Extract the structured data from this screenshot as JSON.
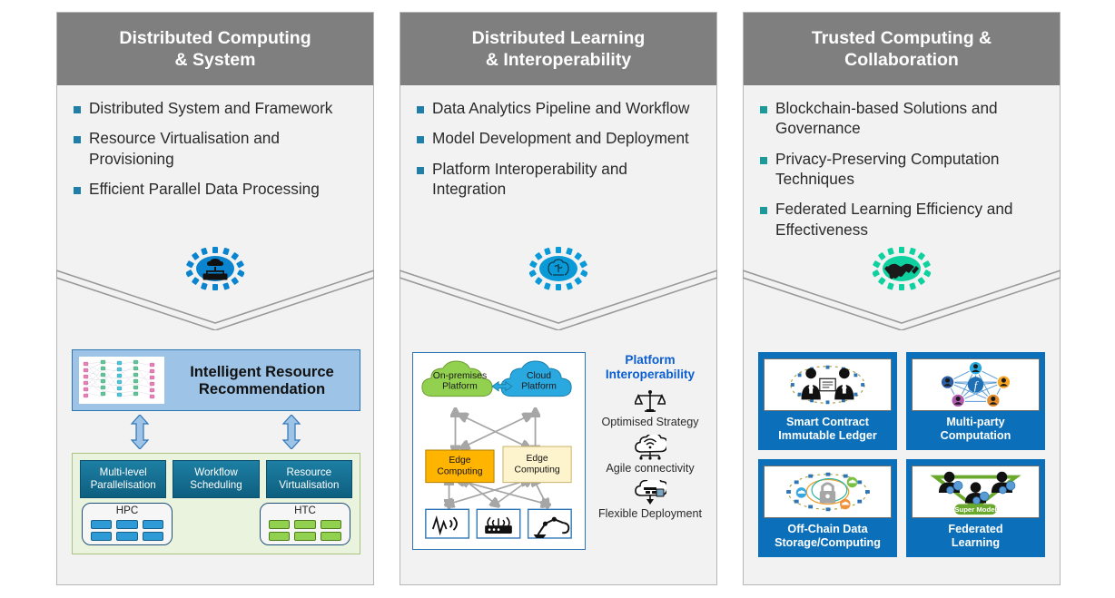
{
  "columns": [
    {
      "id": "distributed-computing",
      "title": "Distributed Computing\n& System",
      "bullet_color": "#1f7fa8",
      "gear_color": "#0b84d0",
      "gear_icon": "cloud-network-icon",
      "bullets": [
        "Distributed System and Framework",
        "Resource Virtualisation and Provisioning",
        "Efficient Parallel Data Processing"
      ],
      "diagram": {
        "headline": "Intelligent Resource\nRecommendation",
        "headline_image": "neural-network-diagram",
        "connector_icon": "double-headed-vertical-arrow",
        "capabilities": [
          "Multi-level\nParallelisation",
          "Workflow\nScheduling",
          "Resource\nVirtualisation"
        ],
        "clusters": [
          {
            "name": "HPC",
            "node_color": "#2e9bd6",
            "nodes": 6
          },
          {
            "name": "HTC",
            "node_color": "#92d050",
            "nodes": 6
          }
        ]
      }
    },
    {
      "id": "distributed-learning",
      "title": "Distributed Learning\n& Interoperability",
      "bullet_color": "#1f7fa8",
      "gear_color": "#0b9ad8",
      "gear_icon": "ai-brain-head-icon",
      "bullets": [
        "Data Analytics Pipeline and Workflow",
        "Model Development and Deployment",
        "Platform Interoperability and Integration"
      ],
      "diagram": {
        "clouds": [
          {
            "label": "On-premises\nPlatform",
            "color": "#92d050"
          },
          {
            "label": "Cloud\nPlatform",
            "color": "#2aa9e0"
          }
        ],
        "link_icon": "bidirectional-sync-icon",
        "edges": [
          {
            "label": "Edge\nComputing",
            "color": "#ffb400"
          },
          {
            "label": "Edge\nComputing",
            "color": "#fdf3cc"
          }
        ],
        "devices": [
          "sensor-signal-icon",
          "wifi-router-icon",
          "robot-arm-icon"
        ]
      },
      "interop": {
        "title": "Platform\nInteroperability",
        "title_color": "#0b5fd0",
        "items": [
          {
            "icon": "balance-scales-icon",
            "label": "Optimised Strategy"
          },
          {
            "icon": "cloud-wifi-icon",
            "label": "Agile connectivity"
          },
          {
            "icon": "cloud-deploy-icon",
            "label": "Flexible Deployment"
          }
        ]
      }
    },
    {
      "id": "trusted-computing",
      "title": "Trusted Computing &\nCollaboration",
      "bullet_color": "#1a9a9a",
      "gear_color": "#0fd1a0",
      "gear_icon": "handshake-icon",
      "bullets": [
        "Blockchain-based Solutions and Governance",
        "Privacy-Preserving Computation Techniques",
        "Federated Learning Efficiency and Effectiveness"
      ],
      "tiles": [
        {
          "label": "Smart Contract\nImmutable Ledger",
          "pic": "smart-contract-illustration"
        },
        {
          "label": "Multi-party\nComputation",
          "pic": "multiparty-network-illustration"
        },
        {
          "label": "Off-Chain Data\nStorage/Computing",
          "pic": "offchain-lock-illustration"
        },
        {
          "label": "Federated\nLearning",
          "pic": "federated-learning-illustration",
          "inner_label": "Super Model"
        }
      ]
    }
  ],
  "theme": {
    "header_bg": "#7f7f7f",
    "panel_bg": "#f2f2f2",
    "tile_bg": "#0b6fba",
    "accent_blue": "#2e75b6"
  }
}
